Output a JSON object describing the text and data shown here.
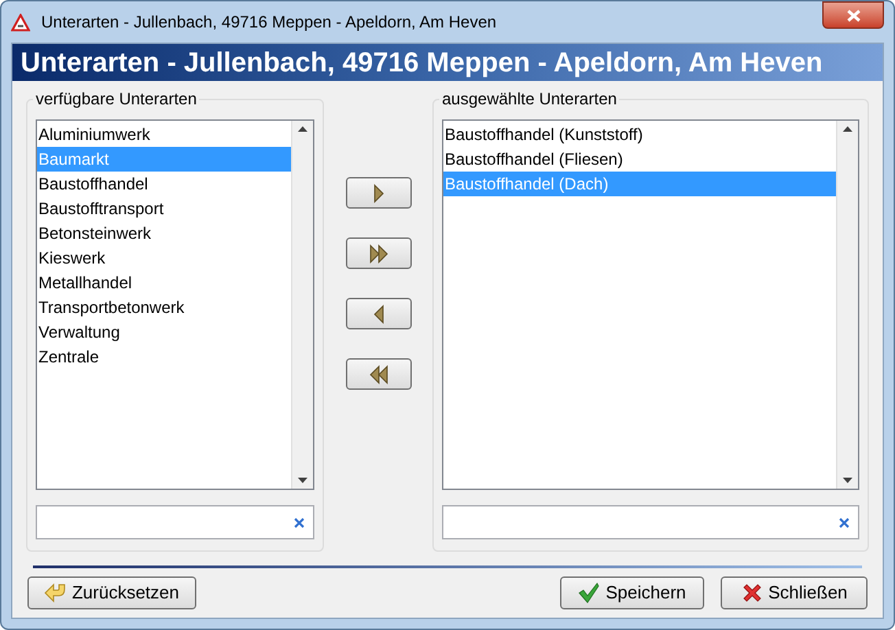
{
  "window": {
    "title": "Unterarten - Jullenbach, 49716 Meppen - Apeldorn, Am Heven"
  },
  "header": "Unterarten - Jullenbach, 49716 Meppen - Apeldorn, Am Heven",
  "available": {
    "label": "verfügbare Unterarten",
    "items": [
      {
        "label": "Aluminiumwerk",
        "selected": false
      },
      {
        "label": "Baumarkt",
        "selected": true
      },
      {
        "label": "Baustoffhandel",
        "selected": false
      },
      {
        "label": "Baustofftransport",
        "selected": false
      },
      {
        "label": "Betonsteinwerk",
        "selected": false
      },
      {
        "label": "Kieswerk",
        "selected": false
      },
      {
        "label": "Metallhandel",
        "selected": false
      },
      {
        "label": "Transportbetonwerk",
        "selected": false
      },
      {
        "label": "Verwaltung",
        "selected": false
      },
      {
        "label": "Zentrale",
        "selected": false
      }
    ]
  },
  "move_buttons": [
    {
      "kind": "add"
    },
    {
      "kind": "add_all"
    },
    {
      "kind": "remove"
    },
    {
      "kind": "remove_all"
    }
  ],
  "selected": {
    "label": "ausgewählte Unterarten",
    "items": [
      {
        "label": "Baustoffhandel (Kunststoff)",
        "selected": false
      },
      {
        "label": "Baustoffhandel (Fliesen)",
        "selected": false
      },
      {
        "label": "Baustoffhandel (Dach)",
        "selected": true
      }
    ]
  },
  "buttons": [
    {
      "kind": "reset",
      "label": "Zurücksetzen"
    },
    {
      "kind": "save",
      "label": "Speichern"
    },
    {
      "kind": "close",
      "label": "Schließen"
    }
  ]
}
